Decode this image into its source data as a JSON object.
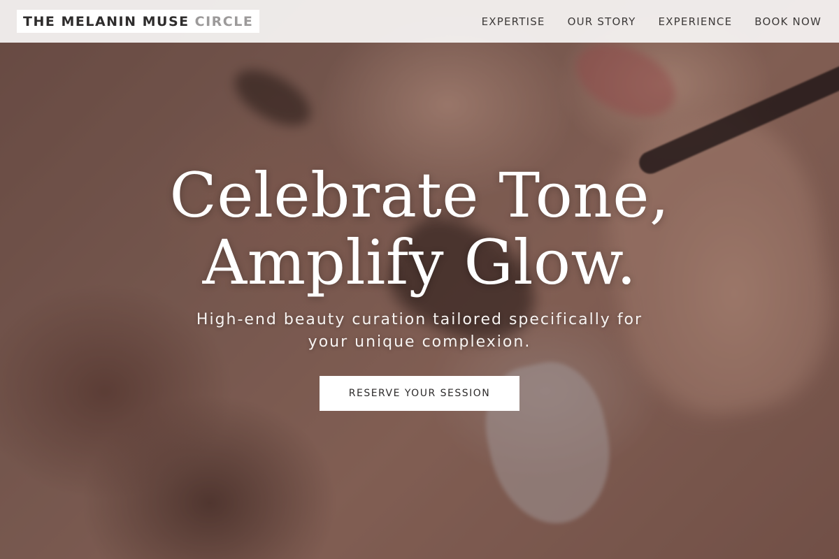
{
  "brand": {
    "name_primary": "THE MELANIN MUSE",
    "name_secondary": "CIRCLE"
  },
  "nav": {
    "items": [
      "EXPERTISE",
      "OUR STORY",
      "EXPERIENCE",
      "BOOK NOW"
    ]
  },
  "hero": {
    "headline_line1": "Celebrate Tone,",
    "headline_line2": "Amplify Glow.",
    "subheadline": "High-end beauty curation tailored specifically for your unique complexion.",
    "cta_label": "RESERVE YOUR SESSION"
  },
  "colors": {
    "header_bg": "#f5f3f2",
    "text_dark": "#3d3a39",
    "brand_muted": "#9c9a9a",
    "cta_bg": "#ffffff"
  }
}
